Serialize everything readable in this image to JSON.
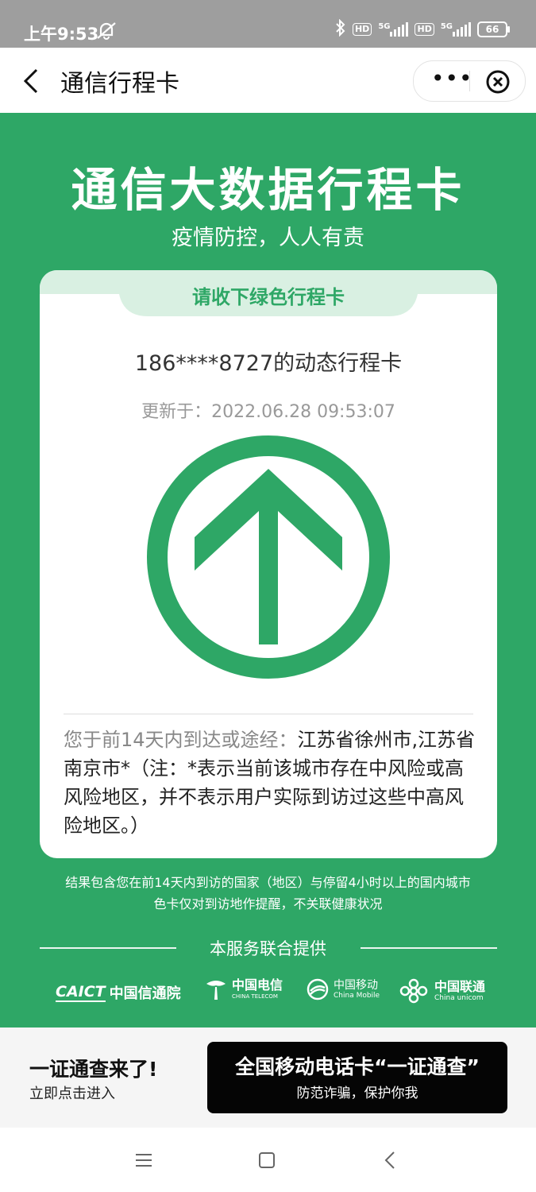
{
  "status_bar": {
    "time": "上午9:53",
    "hd1": "HD",
    "net1": "5G",
    "hd2": "HD",
    "net2": "5G",
    "battery": "66"
  },
  "nav": {
    "title": "通信行程卡",
    "icons": {
      "back": "chevron-left-icon",
      "more": "more-icon",
      "close": "close-circle-icon"
    }
  },
  "header": {
    "title": "通信大数据行程卡",
    "subtitle": "疫情防控，人人有责"
  },
  "card": {
    "tab_label": "请收下绿色行程卡",
    "phone_line": "186****8727的动态行程卡",
    "updated": "更新于：2022.06.28 09:53:07",
    "status_color": "#2ea766",
    "visited_label": "您于前14天内到达或途经：",
    "visited_text": "江苏省徐州市,江苏省南京市*（注：*表示当前该城市存在中风险或高风险地区，并不表示用户实际到访过这些中高风险地区。）"
  },
  "notes": {
    "line1": "结果包含您在前14天内到访的国家（地区）与停留4小时以上的国内城市",
    "line2": "色卡仅对到访地作提醒，不关联健康状况"
  },
  "providers": {
    "label": "本服务联合提供",
    "items": [
      {
        "name": "中国信通院",
        "mark": "CAICT"
      },
      {
        "name": "中国电信",
        "sub": "CHINA TELECOM"
      },
      {
        "name": "中国移动",
        "sub": "China Mobile"
      },
      {
        "name": "中国联通",
        "sub": "China unicom"
      }
    ]
  },
  "banner": {
    "title": "一证通查来了!",
    "subtitle": "立即点击进入",
    "ad_title": "全国移动电话卡“一证通查”",
    "ad_subtitle": "防范诈骗，保护你我"
  }
}
